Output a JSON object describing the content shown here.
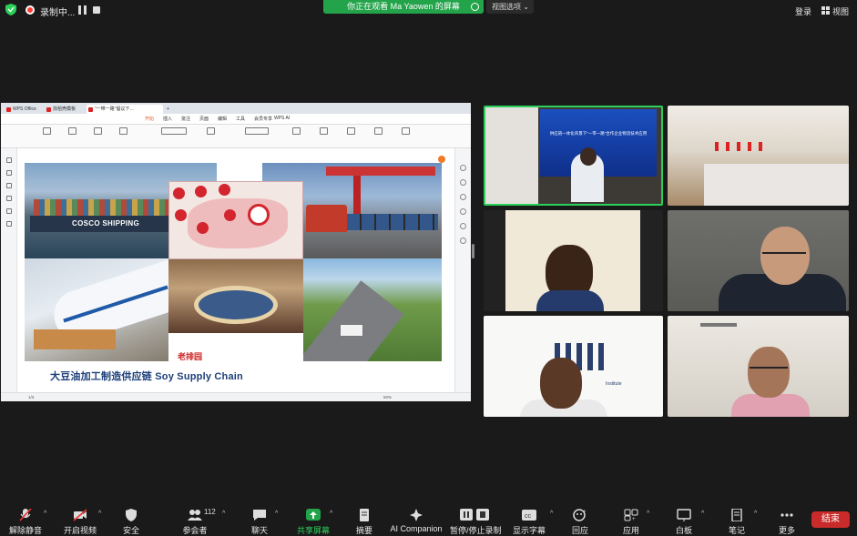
{
  "topbar": {
    "recording_label": "录制中...",
    "view_banner": "你正在观看 Ma Yaowen 的屏幕",
    "view_options": "视图选项",
    "login": "登录",
    "view": "视图"
  },
  "wps": {
    "tabs": [
      "WPS Office",
      "找稻壳模板",
      "“一带一路”倡议下…"
    ],
    "menu": [
      "开始",
      "插入",
      "批注",
      "页面",
      "编辑",
      "工具",
      "会员专享",
      "WPS AI"
    ],
    "status_left": "1/3",
    "status_zoom": "50%"
  },
  "document": {
    "ship_label": "COSCO SHIPPING",
    "watermark": "老排园",
    "heading": "大豆油加工制造供应链  Soy Supply Chain"
  },
  "tiles": {
    "t1_screen_title": "供应链一体化背景下“一带一路”合作企业物流技术应用",
    "t5_logo_text": "Institute"
  },
  "toolbar": {
    "items": [
      {
        "label": "解除静音",
        "icon": "mic-muted-icon"
      },
      {
        "label": "开启视频",
        "icon": "video-off-icon"
      },
      {
        "label": "安全",
        "icon": "shield-icon"
      },
      {
        "label": "参会者",
        "icon": "participants-icon",
        "count": "112"
      },
      {
        "label": "聊天",
        "icon": "chat-icon"
      },
      {
        "label": "共享屏幕",
        "icon": "share-screen-icon"
      },
      {
        "label": "摘要",
        "icon": "summary-icon"
      },
      {
        "label": "AI Companion",
        "icon": "ai-companion-icon"
      },
      {
        "label": "暂停/停止录制",
        "icon": "pause-record-icon"
      },
      {
        "label": "显示字幕",
        "icon": "captions-icon"
      },
      {
        "label": "回应",
        "icon": "reaction-icon"
      },
      {
        "label": "应用",
        "icon": "apps-icon"
      },
      {
        "label": "白板",
        "icon": "whiteboard-icon"
      },
      {
        "label": "笔记",
        "icon": "notes-icon"
      },
      {
        "label": "更多",
        "icon": "more-icon"
      }
    ],
    "end_label": "结束"
  },
  "colors": {
    "share_green": "#23a34a",
    "end_red": "#c92b2b",
    "active_speaker": "#2bd05a"
  }
}
